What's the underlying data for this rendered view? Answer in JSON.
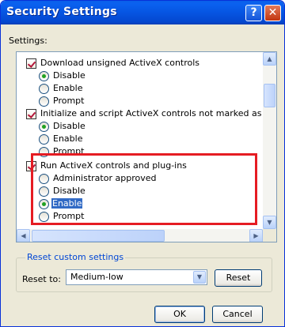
{
  "window": {
    "title": "Security Settings",
    "help_glyph": "?",
    "close_glyph": "✕"
  },
  "settings_label": "Settings:",
  "list": [
    {
      "type": "setting",
      "text": "Download unsigned ActiveX controls"
    },
    {
      "type": "option",
      "text": "Disable",
      "selected": true
    },
    {
      "type": "option",
      "text": "Enable",
      "selected": false
    },
    {
      "type": "option",
      "text": "Prompt",
      "selected": false
    },
    {
      "type": "setting",
      "text": "Initialize and script ActiveX controls not marked as safe"
    },
    {
      "type": "option",
      "text": "Disable",
      "selected": true
    },
    {
      "type": "option",
      "text": "Enable",
      "selected": false
    },
    {
      "type": "option",
      "text": "Prompt",
      "selected": false
    },
    {
      "type": "setting",
      "text": "Run ActiveX controls and plug-ins"
    },
    {
      "type": "option",
      "text": "Administrator approved",
      "selected": false
    },
    {
      "type": "option",
      "text": "Disable",
      "selected": false
    },
    {
      "type": "option",
      "text": "Enable",
      "selected": true
    },
    {
      "type": "option",
      "text": "Prompt",
      "selected": false
    }
  ],
  "scroll": {
    "up": "▲",
    "down": "▼",
    "left": "◀",
    "right": "▶"
  },
  "reset_group": {
    "legend": "Reset custom settings",
    "reset_to_label": "Reset to:",
    "reset_to_value": "Medium-low",
    "dropdown_arrow": "▼",
    "reset_button": "Reset"
  },
  "buttons": {
    "ok": "OK",
    "cancel": "Cancel"
  },
  "colors": {
    "title_bar": "#0655e2",
    "highlight_box": "#e51c23",
    "selected_item_bg": "#316ac5",
    "group_label": "#0046d5"
  }
}
